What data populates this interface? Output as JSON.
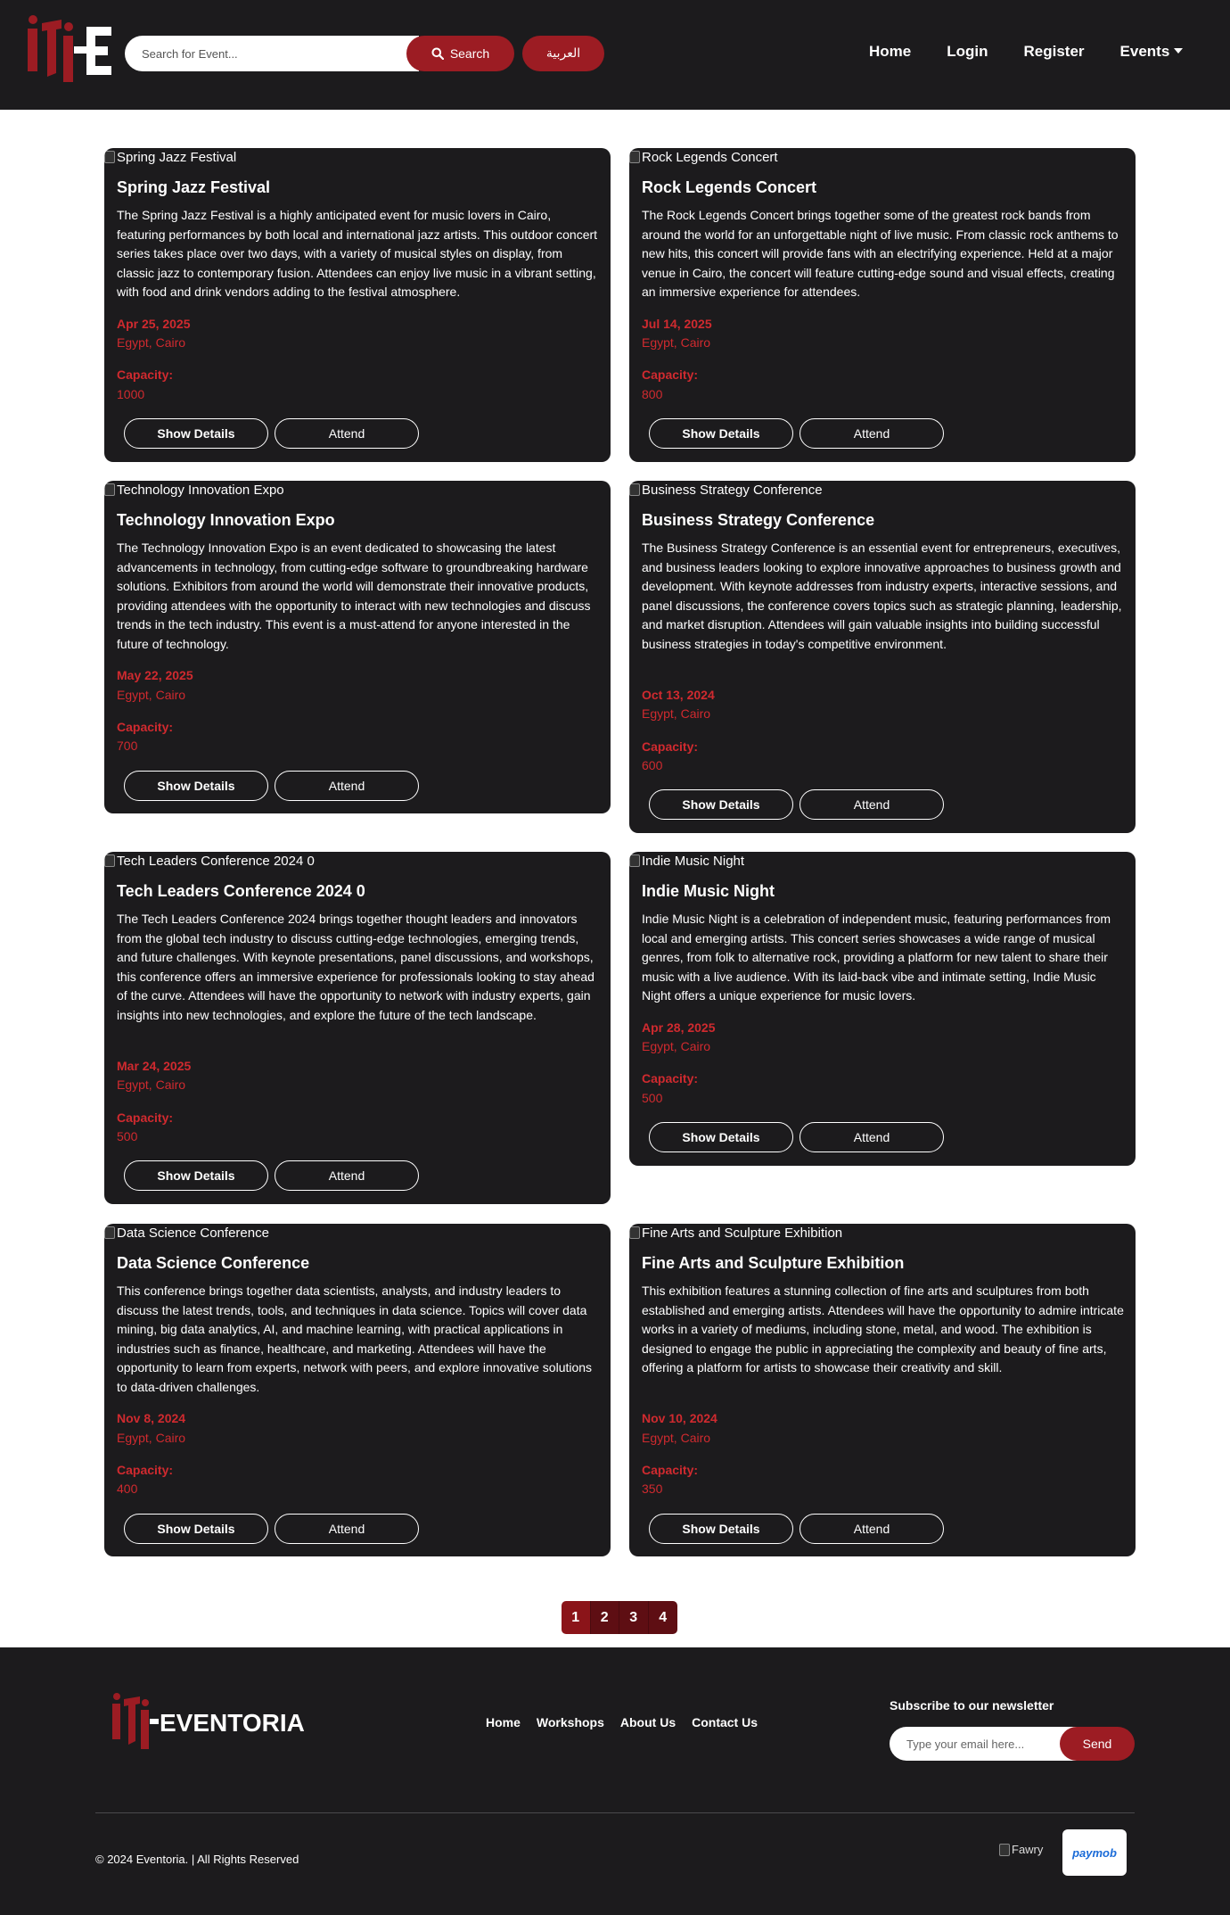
{
  "header": {
    "search_placeholder": "Search for Event...",
    "search_button": "Search",
    "language_button": "العربية",
    "nav": [
      "Home",
      "Login",
      "Register",
      "Events"
    ]
  },
  "events": [
    {
      "image_alt": "Spring Jazz Festival",
      "title": "Spring Jazz Festival",
      "description": "The Spring Jazz Festival is a highly anticipated event for music lovers in Cairo, featuring performances by both local and international jazz artists. This outdoor concert series takes place over two days, with a variety of musical styles on display, from classic jazz to contemporary fusion. Attendees can enjoy live music in a vibrant setting, with food and drink vendors adding to the festival atmosphere.",
      "date": "Apr 25, 2025",
      "location": "Egypt, Cairo",
      "capacity_label": "Capacity:",
      "capacity": "1000",
      "details_button": "Show Details",
      "attend_button": "Attend"
    },
    {
      "image_alt": "Rock Legends Concert",
      "title": "Rock Legends Concert",
      "description": "The Rock Legends Concert brings together some of the greatest rock bands from around the world for an unforgettable night of live music. From classic rock anthems to new hits, this concert will provide fans with an electrifying experience. Held at a major venue in Cairo, the concert will feature cutting-edge sound and visual effects, creating an immersive experience for attendees.",
      "date": "Jul 14, 2025",
      "location": "Egypt, Cairo",
      "capacity_label": "Capacity:",
      "capacity": "800",
      "details_button": "Show Details",
      "attend_button": "Attend"
    },
    {
      "image_alt": "Technology Innovation Expo",
      "title": "Technology Innovation Expo",
      "description": "The Technology Innovation Expo is an event dedicated to showcasing the latest advancements in technology, from cutting-edge software to groundbreaking hardware solutions. Exhibitors from around the world will demonstrate their innovative products, providing attendees with the opportunity to interact with new technologies and discuss trends in the tech industry. This event is a must-attend for anyone interested in the future of technology.",
      "date": "May 22, 2025",
      "location": "Egypt, Cairo",
      "capacity_label": "Capacity:",
      "capacity": "700",
      "details_button": "Show Details",
      "attend_button": "Attend"
    },
    {
      "image_alt": "Business Strategy Conference",
      "title": "Business Strategy Conference",
      "description": "The Business Strategy Conference is an essential event for entrepreneurs, executives, and business leaders looking to explore innovative approaches to business growth and development. With keynote addresses from industry experts, interactive sessions, and panel discussions, the conference covers topics such as strategic planning, leadership, and market disruption. Attendees will gain valuable insights into building successful business strategies in today's competitive environment.",
      "date": "Oct 13, 2024",
      "location": "Egypt, Cairo",
      "capacity_label": "Capacity:",
      "capacity": "600",
      "details_button": "Show Details",
      "attend_button": "Attend"
    },
    {
      "image_alt": "Tech Leaders Conference 2024 0",
      "title": "Tech Leaders Conference 2024 0",
      "description": "The Tech Leaders Conference 2024 brings together thought leaders and innovators from the global tech industry to discuss cutting-edge technologies, emerging trends, and future challenges. With keynote presentations, panel discussions, and workshops, this conference offers an immersive experience for professionals looking to stay ahead of the curve. Attendees will have the opportunity to network with industry experts, gain insights into new technologies, and explore the future of the tech landscape.",
      "date": "Mar 24, 2025",
      "location": "Egypt, Cairo",
      "capacity_label": "Capacity:",
      "capacity": "500",
      "details_button": "Show Details",
      "attend_button": "Attend"
    },
    {
      "image_alt": "Indie Music Night",
      "title": "Indie Music Night",
      "description": "Indie Music Night is a celebration of independent music, featuring performances from local and emerging artists. This concert series showcases a wide range of musical genres, from folk to alternative rock, providing a platform for new talent to share their music with a live audience. With its laid-back vibe and intimate setting, Indie Music Night offers a unique experience for music lovers.",
      "date": "Apr 28, 2025",
      "location": "Egypt, Cairo",
      "capacity_label": "Capacity:",
      "capacity": "500",
      "details_button": "Show Details",
      "attend_button": "Attend"
    },
    {
      "image_alt": "Data Science Conference",
      "title": "Data Science Conference",
      "description": "This conference brings together data scientists, analysts, and industry leaders to discuss the latest trends, tools, and techniques in data science. Topics will cover data mining, big data analytics, AI, and machine learning, with practical applications in industries such as finance, healthcare, and marketing. Attendees will have the opportunity to learn from experts, network with peers, and explore innovative solutions to data-driven challenges.",
      "date": "Nov 8, 2024",
      "location": "Egypt, Cairo",
      "capacity_label": "Capacity:",
      "capacity": "400",
      "details_button": "Show Details",
      "attend_button": "Attend"
    },
    {
      "image_alt": "Fine Arts and Sculpture Exhibition",
      "title": "Fine Arts and Sculpture Exhibition",
      "description": "This exhibition features a stunning collection of fine arts and sculptures from both established and emerging artists. Attendees will have the opportunity to admire intricate works in a variety of mediums, including stone, metal, and wood. The exhibition is designed to engage the public in appreciating the complexity and beauty of fine arts, offering a platform for artists to showcase their creativity and skill.",
      "date": "Nov 10, 2024",
      "location": "Egypt, Cairo",
      "capacity_label": "Capacity:",
      "capacity": "350",
      "details_button": "Show Details",
      "attend_button": "Attend"
    }
  ],
  "pagination": [
    "1",
    "2",
    "3",
    "4"
  ],
  "footer": {
    "logo_text": "EVENTORIA",
    "links": [
      "Home",
      "Workshops",
      "About Us",
      "Contact Us"
    ],
    "newsletter_title": "Subscribe to our newsletter",
    "newsletter_placeholder": "Type your email here...",
    "send_button": "Send",
    "copyright": "© 2024 Eventoria. | All Rights Reserved",
    "fawry_alt": "Fawry",
    "paymob": "paymob"
  },
  "colors": {
    "dark": "#1c1b1d",
    "accent": "#9c1c23",
    "date_red": "#d02a2f"
  }
}
